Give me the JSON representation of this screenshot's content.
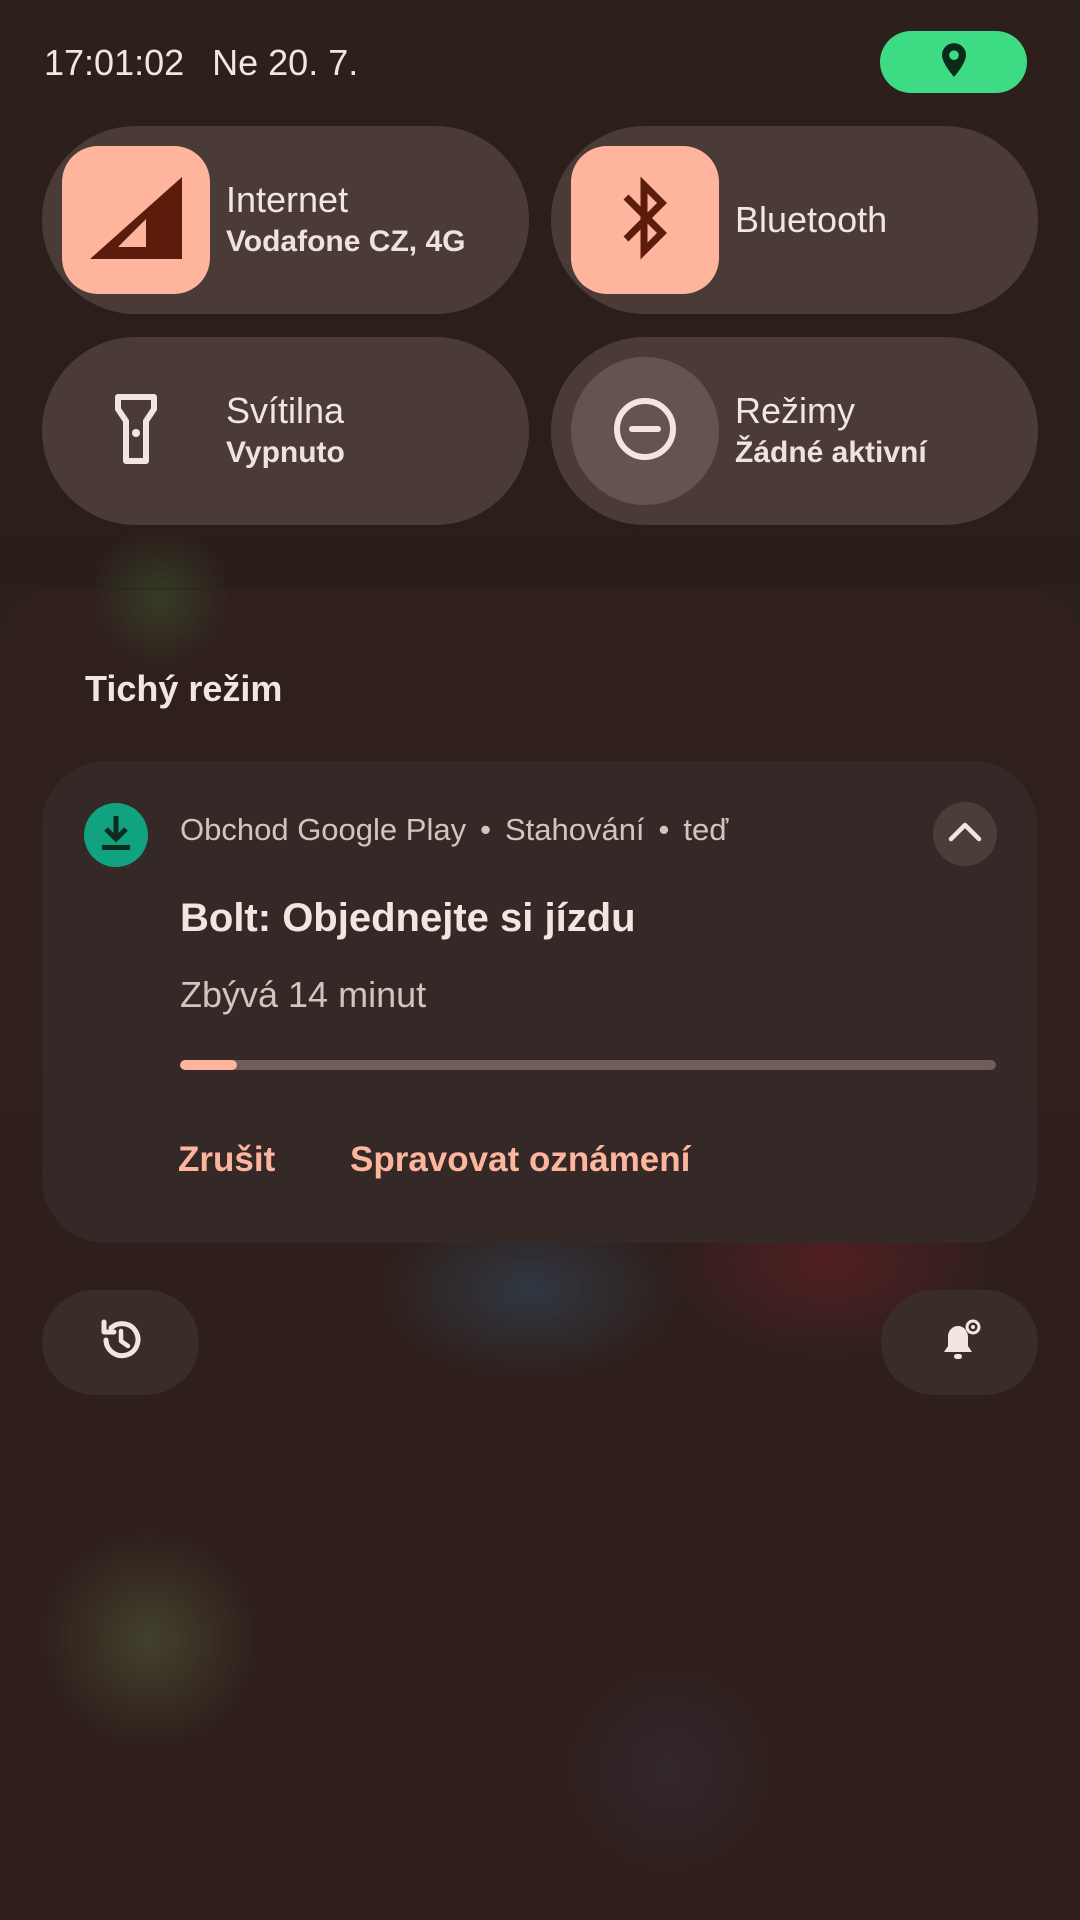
{
  "status": {
    "time": "17:01:02",
    "date": "Ne 20. 7."
  },
  "quick_settings": {
    "tiles": [
      {
        "label": "Internet",
        "sub": "Vodafone CZ, 4G",
        "icon": "signal-icon",
        "state": "active"
      },
      {
        "label": "Bluetooth",
        "sub": "",
        "icon": "bluetooth-icon",
        "state": "active"
      },
      {
        "label": "Svítilna",
        "sub": "Vypnuto",
        "icon": "flashlight-icon",
        "state": "off"
      },
      {
        "label": "Režimy",
        "sub": "Žádné aktivní",
        "icon": "do-not-disturb-icon",
        "state": "off"
      }
    ]
  },
  "section": {
    "title": "Tichý režim"
  },
  "notification": {
    "app_name": "Obchod Google Play",
    "channel": "Stahování",
    "time": "teď",
    "title": "Bolt: Objednejte si jízdu",
    "text": "Zbývá 14 minut",
    "progress_percent": 7,
    "actions": {
      "cancel": "Zrušit",
      "manage": "Spravovat oznámení"
    }
  },
  "colors": {
    "accent": "#ffb59d",
    "location_pill": "#3ddc84",
    "app_icon": "#11a37f"
  }
}
